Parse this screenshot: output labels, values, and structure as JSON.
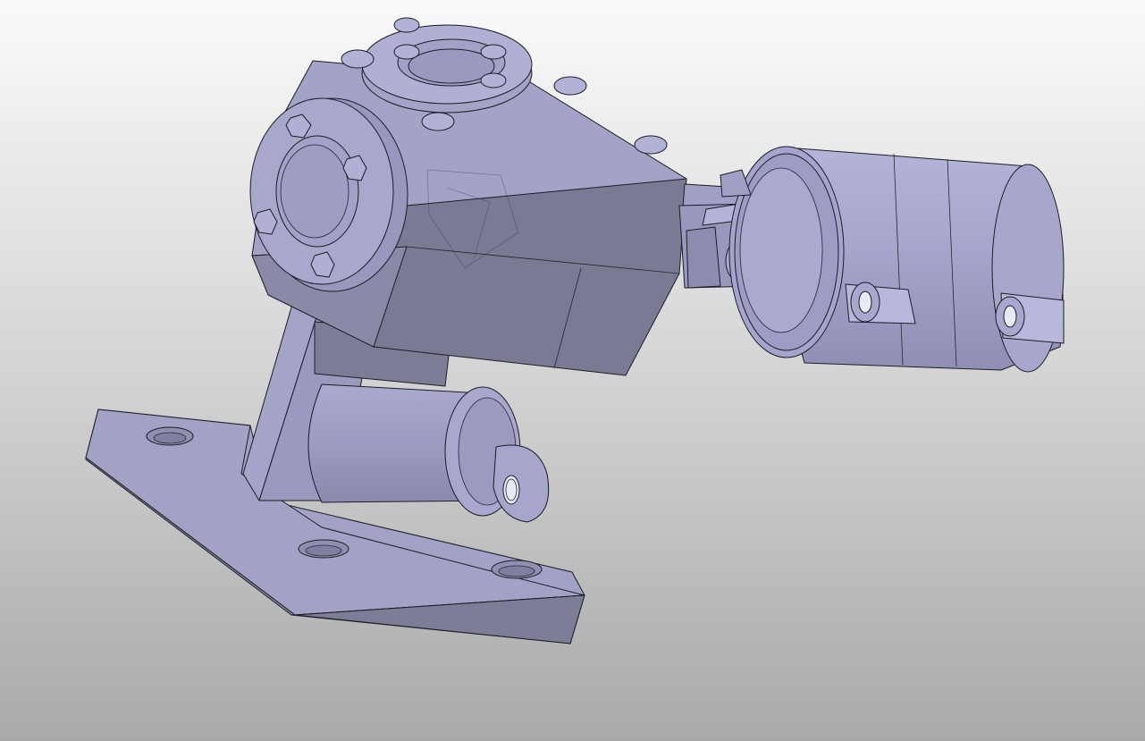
{
  "viewport": {
    "background_top": "#fafafa",
    "background_bottom": "#a9a9a9",
    "model_color": "#a3a3c8",
    "model_shade": "#7b7b95",
    "model_edge": "#1c1c24"
  },
  "model": {
    "parts": [
      "base-plate",
      "vertical-support-column",
      "lower-cylinder",
      "gearbox-housing",
      "top-bearing-flange",
      "front-bearing-flange",
      "universal-joint",
      "drive-motor"
    ]
  }
}
